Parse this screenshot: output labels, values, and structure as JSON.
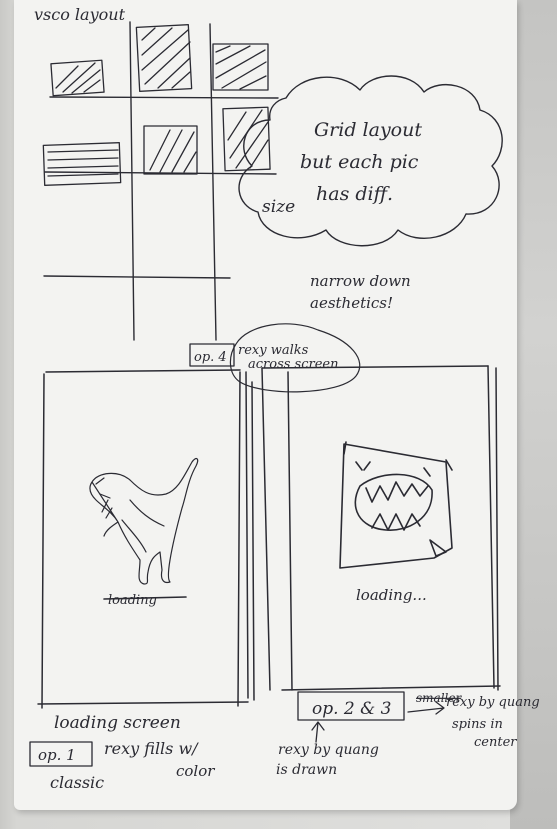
{
  "sketch": {
    "title": "vsco layout",
    "cloud_note": [
      "Grid layout",
      "but each pic",
      "has diff.",
      "size"
    ],
    "aesthetics_note": [
      "narrow down",
      "aesthetics!"
    ],
    "op4_box": "op. 4",
    "op4_note": [
      "rexy walks",
      "across screen"
    ],
    "left_screen_scribble": "loading",
    "right_screen_text": "loading...",
    "left_caption": "loading screen",
    "op1_box": "op. 1",
    "op1_note": "rexy fills w/",
    "op1_note_color": "color",
    "op1_classic": "classic",
    "op23_box": "op. 2 & 3",
    "op2_note": [
      "rexy by quang",
      "is drawn"
    ],
    "op3_note_scratched": "smaller",
    "op3_note": [
      "rexy by quang",
      "spins in",
      "center"
    ]
  },
  "colors": {
    "ink": "#2b2b33",
    "paper": "#f3f3f1",
    "background": "#cfcfcd"
  }
}
